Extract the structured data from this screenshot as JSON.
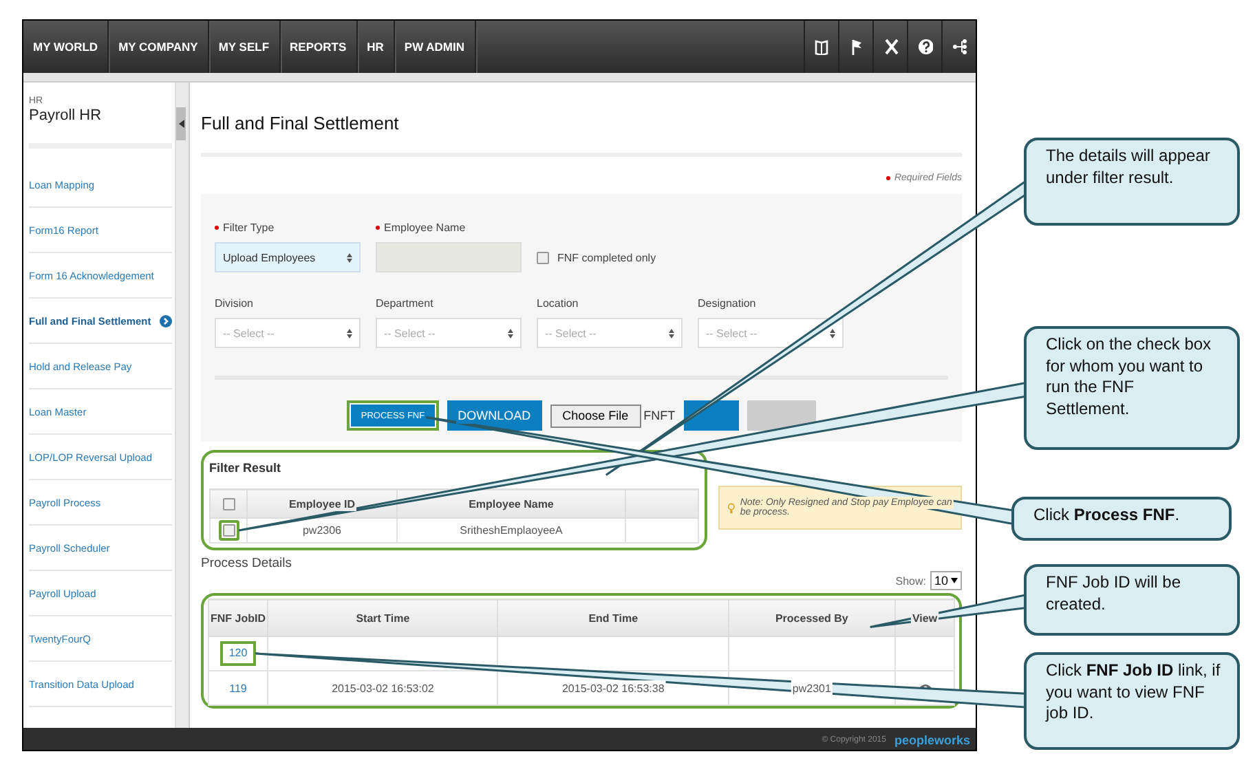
{
  "top_nav": {
    "items": [
      "MY WORLD",
      "MY COMPANY",
      "MY SELF",
      "REPORTS",
      "HR",
      "PW ADMIN"
    ]
  },
  "sidebar": {
    "section": "HR",
    "title": "Payroll HR",
    "items": [
      {
        "label": "Loan Mapping",
        "selected": false
      },
      {
        "label": "Form16 Report",
        "selected": false
      },
      {
        "label": "Form 16 Acknowledgement",
        "selected": false
      },
      {
        "label": "Full and Final Settlement",
        "selected": true
      },
      {
        "label": "Hold and Release Pay",
        "selected": false
      },
      {
        "label": "Loan Master",
        "selected": false
      },
      {
        "label": "LOP/LOP Reversal Upload",
        "selected": false
      },
      {
        "label": "Payroll Process",
        "selected": false
      },
      {
        "label": "Payroll Scheduler",
        "selected": false
      },
      {
        "label": "Payroll Upload",
        "selected": false
      },
      {
        "label": "TwentyFourQ",
        "selected": false
      },
      {
        "label": "Transition Data Upload",
        "selected": false
      }
    ]
  },
  "page": {
    "title": "Full and Final Settlement",
    "required_note": "Required Fields"
  },
  "filter": {
    "fields": [
      {
        "kind": "select",
        "label": "Filter Type",
        "required": true,
        "value": "Upload Employees"
      },
      {
        "kind": "text",
        "label": "Employee Name",
        "required": true,
        "disabled": true
      },
      {
        "kind": "checkbox",
        "label": "FNF completed only",
        "checked": false
      }
    ],
    "selects": [
      {
        "label": "Division",
        "placeholder": "-- Select --"
      },
      {
        "label": "Department",
        "placeholder": "-- Select --"
      },
      {
        "label": "Location",
        "placeholder": "-- Select --"
      },
      {
        "label": "Designation",
        "placeholder": "-- Select --"
      }
    ],
    "buttons": [
      {
        "kind": "process",
        "label": "PROCESS FNF",
        "highlighted": true
      },
      {
        "kind": "primary",
        "label": "DOWNLOAD",
        "highlighted": false
      },
      {
        "kind": "file",
        "label": "Choose File",
        "file_text": "FNFT",
        "highlighted": false
      },
      {
        "kind": "primary",
        "highlighted": false
      },
      {
        "kind": "secondary",
        "highlighted": false
      }
    ]
  },
  "filter_result": {
    "title": "Filter Result",
    "header_checked": false,
    "columns": [
      "Employee ID",
      "Employee Name"
    ],
    "rows": [
      {
        "checked": false,
        "highlighted": true,
        "cells": [
          "pw2306",
          "SritheshEmplaoyeeA"
        ]
      }
    ],
    "note": "Note: Only Resigned and Stop pay Employee can be process."
  },
  "process_details": {
    "title": "Process Details",
    "show_label": "Show:",
    "page_size": "10",
    "columns": [
      "FNF JobID",
      "Start Time",
      "End Time",
      "Processed By",
      "View"
    ],
    "rows": [
      {
        "job_id": "120",
        "highlighted": true,
        "viewable": false
      },
      {
        "job_id": "119",
        "start_time": "2015-03-02 16:53:02",
        "end_time": "2015-03-02 16:53:38",
        "processed_by": "pw2301",
        "highlighted": false,
        "viewable": true
      }
    ]
  },
  "footer": {
    "copyright": "© Copyright 2015",
    "logo": "peopleworks"
  },
  "callouts": [
    {
      "text": "The details will appear under filter result."
    },
    {
      "text": "Click on the check box for whom you want to run the FNF Settlement."
    },
    {
      "text": "Click **Process FNF**."
    },
    {
      "text": "FNF Job ID will be created."
    },
    {
      "text": "Click **FNF Job ID** link, if you want to view FNF job ID."
    }
  ]
}
